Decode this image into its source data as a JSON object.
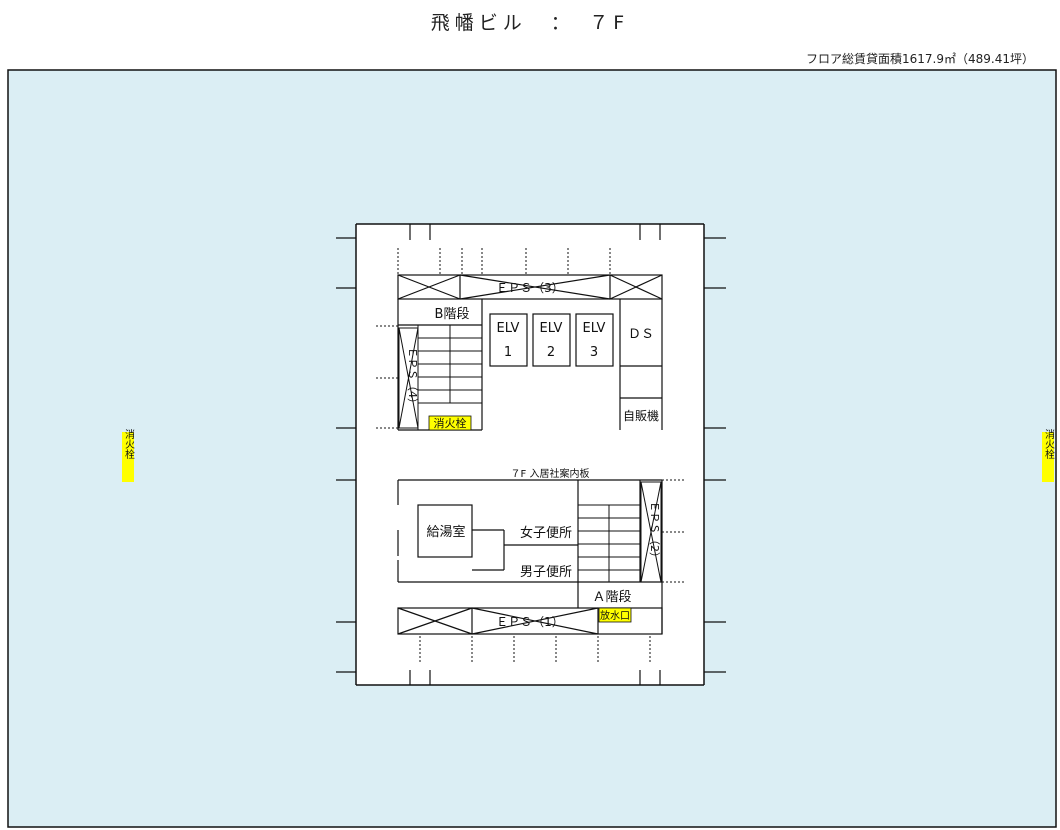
{
  "title": "飛幡ビル　：　７F",
  "area_note": "フロア総賃貸面積1617.9㎡（489.41坪）",
  "colors": {
    "floor": "#dbeef4",
    "core": "#ffffff",
    "line": "#111111",
    "highlight": "#ffff00"
  },
  "core": {
    "eps3": "ＥＰＳ（3）",
    "eps1": "ＥＰＳ（1）",
    "eps4": "ＥＰＳ（4）",
    "eps2": "ＥＰＳ（2）",
    "b_stairs": "B階段",
    "a_stairs": "Ａ階段",
    "elv1_top": "ELV",
    "elv1_num": "1",
    "elv2_top": "ELV",
    "elv2_num": "2",
    "elv3_top": "ELV",
    "elv3_num": "3",
    "ds": "ＤＳ",
    "vending": "自販機",
    "hydrant_core": "消火栓",
    "directory": "７F 入居社案内板",
    "women_wc": "女子便所",
    "men_wc": "男子便所",
    "kitchen": "給湯室",
    "water_outlet": "放水口"
  },
  "hydrant_left": "消火栓",
  "hydrant_right": "消火栓"
}
